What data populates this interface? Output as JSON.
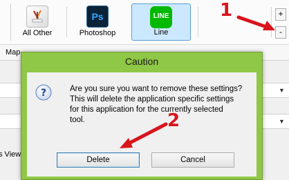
{
  "toolbar": {
    "apps": [
      {
        "label": "All Other",
        "icon": "brush-app-icon"
      },
      {
        "label": "Photoshop",
        "icon": "photoshop-icon",
        "icon_text": "Ps"
      },
      {
        "label": "Line",
        "icon": "line-app-icon",
        "icon_text": "LINE",
        "selected": true
      }
    ],
    "add_button": "+",
    "remove_button": "-"
  },
  "panel": {
    "tab_label": "Map",
    "views_label": "s View"
  },
  "dialog": {
    "title": "Caution",
    "message": "Are you sure you want to remove these settings?\nThis will delete the application specific settings\nfor this application for the currently selected\ntool.",
    "delete_label": "Delete",
    "cancel_label": "Cancel",
    "title_bar_color": "#8fc746"
  },
  "annotations": [
    {
      "number": "1",
      "color": "#d8141c"
    },
    {
      "number": "2",
      "color": "#d8141c"
    }
  ]
}
